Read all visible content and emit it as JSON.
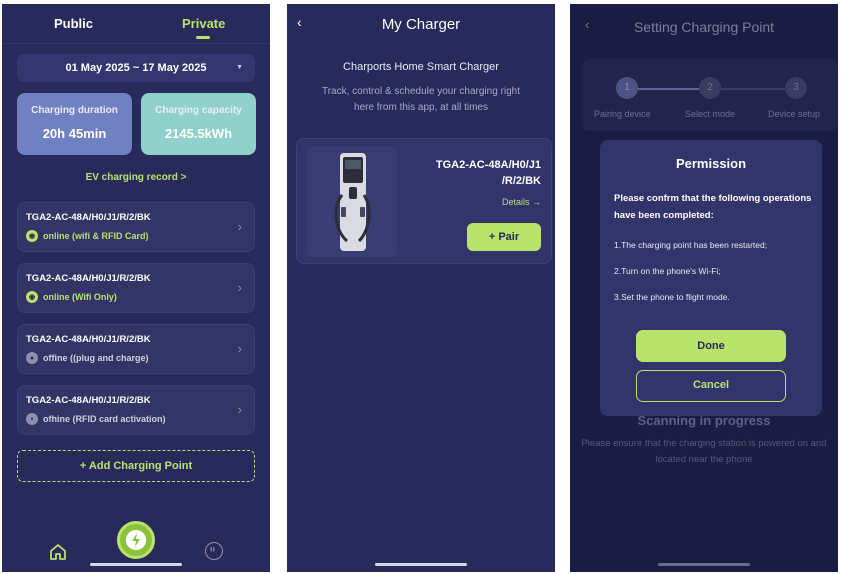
{
  "screen1": {
    "tabs": {
      "public": "Public",
      "private": "Private"
    },
    "date_range": "01 May 2025 ~ 17 May 2025",
    "cards": {
      "duration_label": "Charging duration",
      "duration_value": "20h 45min",
      "capacity_label": "Charging capacity",
      "capacity_value": "2145.5kWh"
    },
    "record_link": "EV charging record >",
    "chargers": [
      {
        "model": "TGA2-AC-48A/H0/J1/R/2/BK",
        "status": "online (wifi & RFID Card)",
        "state": "online",
        "icon": "wifi-icon"
      },
      {
        "model": "TGA2-AC-48A/H0/J1/R/2/BK",
        "status": "online (Wifi Only)",
        "state": "online",
        "icon": "wifi-icon"
      },
      {
        "model": "TGA2-AC-48A/H0/J1/R/2/BK",
        "status": "offine ((plug and charge)",
        "state": "offline",
        "icon": "plug-icon"
      },
      {
        "model": "TGA2-AC-48A/H0/J1/R/2/BK",
        "status": "ofhine (RFID card activation)",
        "state": "offline",
        "icon": "card-icon"
      }
    ],
    "add_button": "+ Add Charging Point"
  },
  "screen2": {
    "title": "My Charger",
    "charger_name": "Charports Home Smart Charger",
    "description": "Track, control & schedule your charging right here from this app, at all times",
    "model_line1": "TGA2-AC-48A/H0/J1",
    "model_line2": "/R/2/BK",
    "details_link": "Details →",
    "pair_button": "+ Pair"
  },
  "screen3": {
    "title": "Setting Charging Point",
    "steps": [
      {
        "num": "1",
        "label": "Pairing device"
      },
      {
        "num": "2",
        "label": "Select mode"
      },
      {
        "num": "3",
        "label": "Device setup"
      }
    ],
    "modal": {
      "title": "Permission",
      "text": "Please confrm that the following operations have been completed:",
      "items": [
        "1.The charging point has been restarted;",
        "2.Turn on the phone's Wi-Fi;",
        "3.Set the phone to flight mode."
      ],
      "done": "Done",
      "cancel": "Cancel"
    },
    "scan_title": "Scanning in progress",
    "scan_desc": "Please ensure that the charging station is powered on and located near the phone"
  },
  "colors": {
    "background": "#282a5c",
    "accent": "#b8e26a",
    "card_duration": "#7180c2",
    "card_capacity": "#8fd0cb"
  }
}
